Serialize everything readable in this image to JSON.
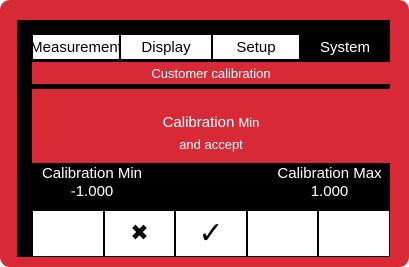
{
  "tabs": [
    {
      "label": "Measurement",
      "active": false
    },
    {
      "label": "Display",
      "active": false
    },
    {
      "label": "Setup",
      "active": false
    },
    {
      "label": "System",
      "active": true
    }
  ],
  "banner": {
    "title": "Customer calibration",
    "line1_main": "Calibration",
    "line1_small": "Min",
    "line2": "and accept"
  },
  "calibration": {
    "min_label": "Calibration Min",
    "min_value": "-1.000",
    "max_label": "Calibration Max",
    "max_value": "1.000"
  },
  "buttons": {
    "cancel_icon": "✖",
    "accept_icon": "✓"
  },
  "colors": {
    "accent": "#d82a36",
    "screen": "#000000",
    "text_light": "#ffffff"
  }
}
